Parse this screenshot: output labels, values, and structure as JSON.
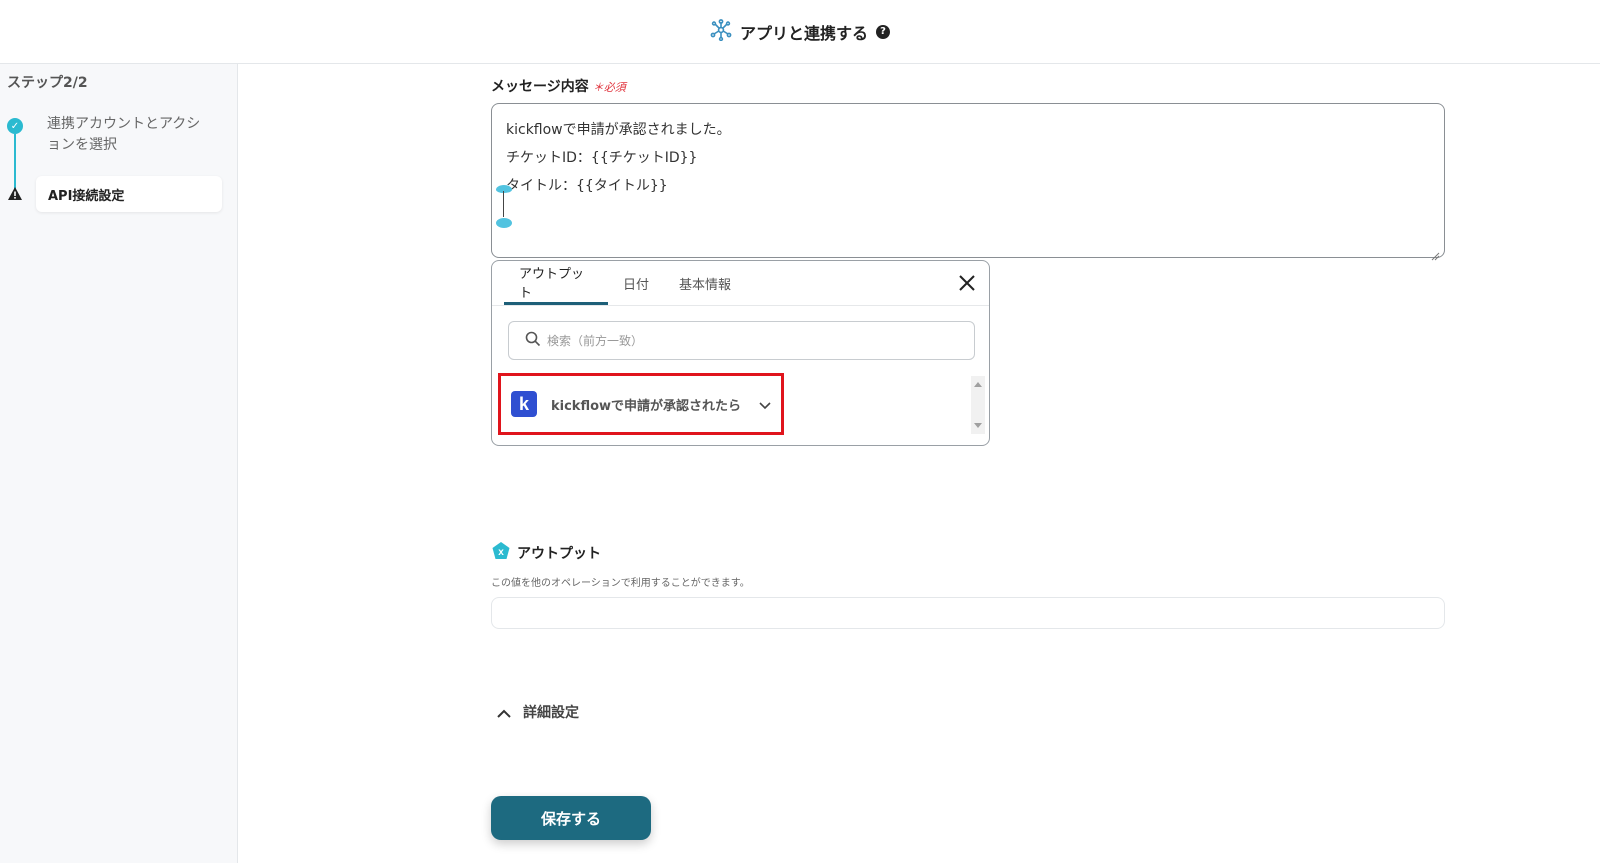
{
  "header": {
    "title": "アプリと連携する",
    "help_icon": "question-circle-icon",
    "app_icon": "integration-hub-icon"
  },
  "sidebar": {
    "step_label": "ステップ2/2",
    "steps": [
      {
        "label": "連携アカウントとアクションを選択",
        "state": "done"
      },
      {
        "label": "API接続設定",
        "state": "current"
      }
    ]
  },
  "form": {
    "message_label": "メッセージ内容",
    "required_label": "＊必須",
    "message_lines": [
      "kickflowで申請が承認されました。",
      "チケットID：{{チケットID}}",
      "タイトル：{{タイトル}}"
    ]
  },
  "popup": {
    "tabs": [
      "アウトプット",
      "日付",
      "基本情報"
    ],
    "active_tab": "アウトプット",
    "search_placeholder": "検索（前方一致）",
    "item_logo_letter": "k",
    "item_label": "kickflowで申請が承認されたら"
  },
  "output": {
    "title": "アウトプット",
    "badge_letter": "x",
    "description": "この値を他のオペレーションで利用することができます。",
    "value": ""
  },
  "advanced": {
    "label": "詳細設定"
  },
  "save_button": "保存する",
  "colors": {
    "accent": "#2bbad0",
    "primary_button": "#1d6a80",
    "highlight": "#e0141c",
    "kickflow_brand": "#2f4fd1"
  }
}
